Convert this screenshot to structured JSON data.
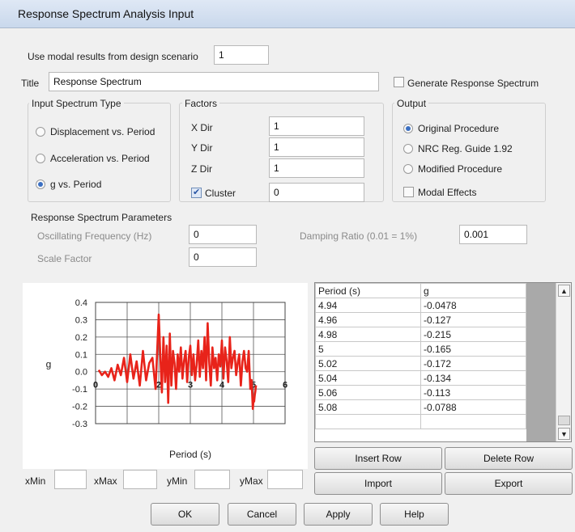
{
  "window": {
    "title": "Response Spectrum Analysis Input"
  },
  "modal": {
    "label": "Use modal results from design scenario",
    "value": "1"
  },
  "title_field": {
    "label": "Title",
    "value": "Response Spectrum"
  },
  "generate": {
    "label": "Generate Response Spectrum",
    "checked": false
  },
  "input_type": {
    "group_label": "Input Spectrum Type",
    "options": [
      {
        "label": "Displacement vs. Period",
        "selected": false
      },
      {
        "label": "Acceleration vs. Period",
        "selected": false
      },
      {
        "label": "g vs. Period",
        "selected": true
      }
    ]
  },
  "factors": {
    "group_label": "Factors",
    "x_label": "X Dir",
    "x_value": "1",
    "y_label": "Y Dir",
    "y_value": "1",
    "z_label": "Z Dir",
    "z_value": "1",
    "cluster_label": "Cluster",
    "cluster_checked": true,
    "cluster_value": "0"
  },
  "output": {
    "group_label": "Output",
    "options": [
      {
        "label": "Original Procedure",
        "selected": true
      },
      {
        "label": "NRC Reg. Guide 1.92",
        "selected": false
      },
      {
        "label": "Modified Procedure",
        "selected": false
      }
    ],
    "modal_effects_label": "Modal Effects",
    "modal_effects_checked": false
  },
  "params": {
    "group_label": "Response Spectrum Parameters",
    "osc_label": "Oscillating Frequency (Hz)",
    "osc_value": "0",
    "damp_label": "Damping Ratio (0.01 = 1%)",
    "damp_value": "0.001",
    "scale_label": "Scale Factor",
    "scale_value": "0"
  },
  "chart_data": {
    "type": "line",
    "xlabel": "Period (s)",
    "ylabel": "g",
    "xlim": [
      0,
      6
    ],
    "ylim": [
      -0.3,
      0.4
    ],
    "x_ticks": [
      "0",
      "2",
      "3",
      "4",
      "5",
      "6"
    ],
    "y_ticks": [
      "0.4",
      "0.3",
      "0.2",
      "0.1",
      "0.0",
      "-0.1",
      "-0.2",
      "-0.3"
    ],
    "grid": true,
    "series_color": "#e8231a",
    "x": [
      0.1,
      0.2,
      0.3,
      0.4,
      0.5,
      0.6,
      0.7,
      0.8,
      0.9,
      1.0,
      1.1,
      1.2,
      1.3,
      1.4,
      1.5,
      1.6,
      1.7,
      1.8,
      1.9,
      2.0,
      2.05,
      2.1,
      2.15,
      2.2,
      2.25,
      2.3,
      2.35,
      2.4,
      2.45,
      2.5,
      2.55,
      2.6,
      2.65,
      2.7,
      2.75,
      2.8,
      2.85,
      2.9,
      2.95,
      3.0,
      3.05,
      3.1,
      3.15,
      3.2,
      3.25,
      3.3,
      3.35,
      3.4,
      3.45,
      3.5,
      3.55,
      3.6,
      3.65,
      3.7,
      3.75,
      3.8,
      3.85,
      3.9,
      3.95,
      4.0,
      4.05,
      4.1,
      4.15,
      4.2,
      4.25,
      4.3,
      4.35,
      4.4,
      4.45,
      4.5,
      4.55,
      4.6,
      4.65,
      4.7,
      4.75,
      4.8,
      4.85,
      4.9,
      4.94,
      4.96,
      4.98,
      5.0,
      5.02,
      5.04,
      5.06,
      5.08
    ],
    "y": [
      0.01,
      -0.02,
      0.0,
      -0.03,
      0.02,
      -0.05,
      0.04,
      -0.02,
      0.08,
      -0.06,
      0.1,
      -0.04,
      0.06,
      -0.08,
      0.12,
      -0.05,
      0.05,
      0.08,
      -0.1,
      0.33,
      0.1,
      -0.12,
      0.2,
      -0.06,
      0.15,
      -0.18,
      0.22,
      -0.08,
      0.12,
      0.05,
      -0.1,
      0.1,
      0.0,
      0.14,
      -0.04,
      0.06,
      0.12,
      -0.06,
      0.08,
      0.15,
      -0.02,
      0.1,
      -0.05,
      0.04,
      0.18,
      -0.03,
      0.12,
      0.02,
      0.2,
      -0.05,
      0.28,
      0.05,
      -0.08,
      0.14,
      0.02,
      0.08,
      -0.05,
      0.1,
      0.03,
      0.18,
      -0.04,
      0.14,
      0.06,
      -0.06,
      0.2,
      0.02,
      0.08,
      0.12,
      -0.02,
      0.05,
      0.1,
      -0.08,
      0.06,
      0.12,
      0.02,
      0.0,
      0.12,
      -0.1,
      -0.0478,
      -0.127,
      -0.215,
      -0.165,
      -0.172,
      -0.134,
      -0.113,
      -0.0788
    ]
  },
  "range": {
    "xmin_label": "xMin",
    "xmax_label": "xMax",
    "ymin_label": "yMin",
    "ymax_label": "yMax"
  },
  "table": {
    "headers": [
      "Period (s)",
      "g"
    ],
    "rows": [
      [
        "4.94",
        "-0.0478"
      ],
      [
        "4.96",
        "-0.127"
      ],
      [
        "4.98",
        "-0.215"
      ],
      [
        "5",
        "-0.165"
      ],
      [
        "5.02",
        "-0.172"
      ],
      [
        "5.04",
        "-0.134"
      ],
      [
        "5.06",
        "-0.113"
      ],
      [
        "5.08",
        "-0.0788"
      ],
      [
        "",
        ""
      ]
    ]
  },
  "buttons": {
    "insert_row": "Insert Row",
    "delete_row": "Delete Row",
    "import": "Import",
    "export": "Export",
    "ok": "OK",
    "cancel": "Cancel",
    "apply": "Apply",
    "help": "Help"
  }
}
